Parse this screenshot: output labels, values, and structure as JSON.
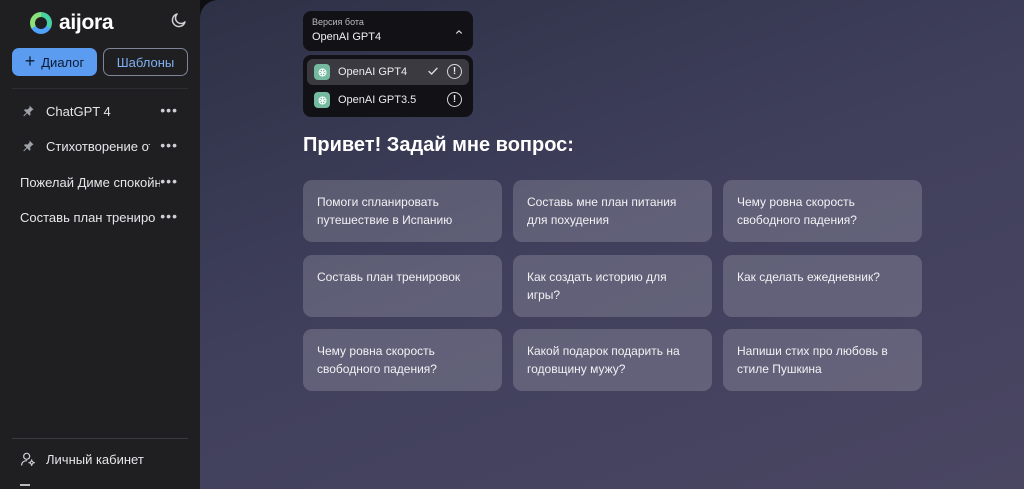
{
  "sidebar": {
    "logo_text": "aijora",
    "new_dialog_label": "Диалог",
    "templates_label": "Шаблоны",
    "chats": [
      {
        "label": "ChatGPT 4",
        "pinned": true
      },
      {
        "label": "Стихотворение от",
        "pinned": true
      },
      {
        "label": "Пожелай Диме спокойн",
        "pinned": false
      },
      {
        "label": "Составь план трениро",
        "pinned": false
      }
    ],
    "cabinet_label": "Личный кабинет"
  },
  "model_select": {
    "caption": "Версия бота",
    "value": "OpenAI GPT4",
    "options": [
      {
        "label": "OpenAI GPT4",
        "selected": true
      },
      {
        "label": "OpenAI GPT3.5",
        "selected": false
      }
    ]
  },
  "main": {
    "greeting": "Привет! Задай мне вопрос:",
    "suggestions": [
      "Помоги спланировать путешествие в Испанию",
      "Составь мне план питания для похудения",
      "Чему ровна скорость свободного падения?",
      "Составь план тренировок",
      "Как создать историю для игры?",
      "Как сделать ежедневник?",
      "Чему ровна скорость свободного падения?",
      "Какой подарок подарить на годовщину мужу?",
      "Напиши стих про любовь в стиле Пушкина"
    ]
  },
  "colors": {
    "accent": "#5b9cf0",
    "sidebar_bg": "#1f1f22",
    "main_bg_start": "#2e3146",
    "main_bg_end": "#4a4662"
  },
  "icons": [
    "theme-moon-icon",
    "plus-icon",
    "pin-icon",
    "more-dots-icon",
    "user-icon",
    "chevron-up-icon",
    "gpt-logo-icon",
    "check-icon",
    "info-icon"
  ]
}
